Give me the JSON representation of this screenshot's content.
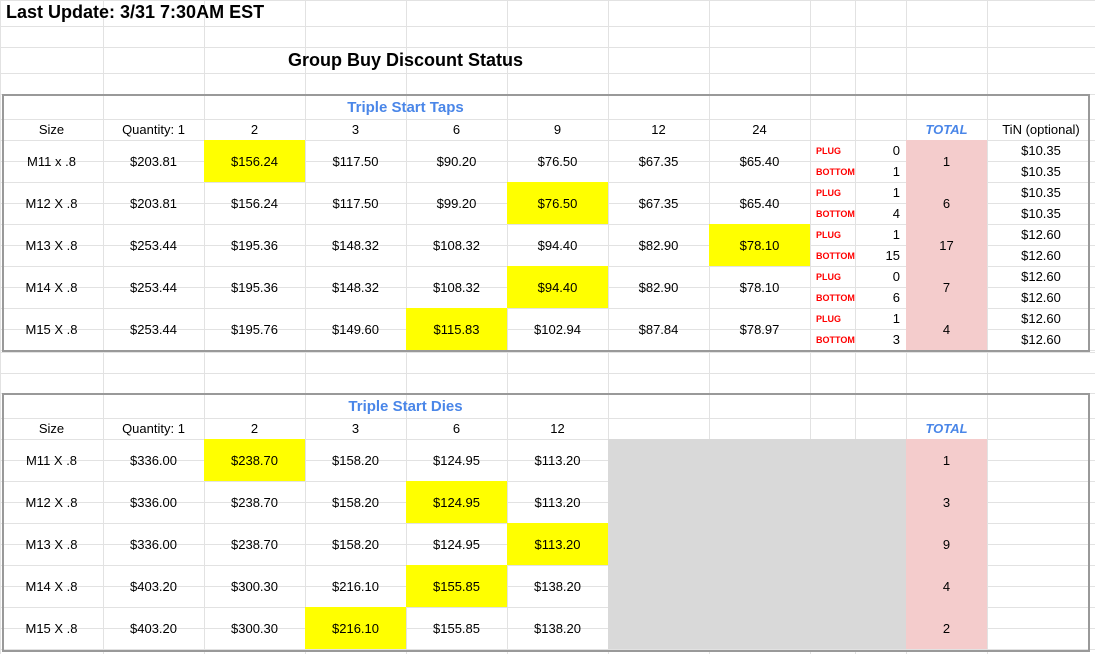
{
  "header": {
    "last_update": "Last Update: 3/31 7:30AM EST",
    "main_title": "Group Buy Discount Status"
  },
  "colors": {
    "highlight": "#ffff00",
    "total_fill": "#f4cccc",
    "blank_fill": "#d9d9d9",
    "section_title": "#4a86e8",
    "plug_bottom_text": "#ff0000"
  },
  "taps": {
    "title": "Triple Start Taps",
    "headers": [
      "Size",
      "Quantity: 1",
      "2",
      "3",
      "6",
      "9",
      "12",
      "24"
    ],
    "total_header": "TOTAL",
    "tin_header": "TiN (optional)",
    "plug_label": "PLUG",
    "bottom_label": "BOTTOM",
    "rows": [
      {
        "size": "M11 x .8",
        "prices": [
          "$203.81",
          "$156.24",
          "$117.50",
          "$90.20",
          "$76.50",
          "$67.35",
          "$65.40"
        ],
        "highlight": 1,
        "plug": "0",
        "bottom": "1",
        "total": "1",
        "tin_plug": "$10.35",
        "tin_bottom": "$10.35"
      },
      {
        "size": "M12 X .8",
        "prices": [
          "$203.81",
          "$156.24",
          "$117.50",
          "$99.20",
          "$76.50",
          "$67.35",
          "$65.40"
        ],
        "highlight": 4,
        "plug": "1",
        "bottom": "4",
        "total": "6",
        "tin_plug": "$10.35",
        "tin_bottom": "$10.35"
      },
      {
        "size": "M13 X .8",
        "prices": [
          "$253.44",
          "$195.36",
          "$148.32",
          "$108.32",
          "$94.40",
          "$82.90",
          "$78.10"
        ],
        "highlight": 6,
        "plug": "1",
        "bottom": "15",
        "total": "17",
        "tin_plug": "$12.60",
        "tin_bottom": "$12.60"
      },
      {
        "size": "M14 X .8",
        "prices": [
          "$253.44",
          "$195.36",
          "$148.32",
          "$108.32",
          "$94.40",
          "$82.90",
          "$78.10"
        ],
        "highlight": 4,
        "plug": "0",
        "bottom": "6",
        "total": "7",
        "tin_plug": "$12.60",
        "tin_bottom": "$12.60"
      },
      {
        "size": "M15 X .8",
        "prices": [
          "$253.44",
          "$195.76",
          "$149.60",
          "$115.83",
          "$102.94",
          "$87.84",
          "$78.97"
        ],
        "highlight": 3,
        "plug": "1",
        "bottom": "3",
        "total": "4",
        "tin_plug": "$12.60",
        "tin_bottom": "$12.60"
      }
    ]
  },
  "dies": {
    "title": "Triple Start Dies",
    "headers": [
      "Size",
      "Quantity: 1",
      "2",
      "3",
      "6",
      "12"
    ],
    "total_header": "TOTAL",
    "rows": [
      {
        "size": "M11 X .8",
        "prices": [
          "$336.00",
          "$238.70",
          "$158.20",
          "$124.95",
          "$113.20"
        ],
        "highlight": 1,
        "total": "1"
      },
      {
        "size": "M12 X .8",
        "prices": [
          "$336.00",
          "$238.70",
          "$158.20",
          "$124.95",
          "$113.20"
        ],
        "highlight": 3,
        "total": "3"
      },
      {
        "size": "M13 X .8",
        "prices": [
          "$336.00",
          "$238.70",
          "$158.20",
          "$124.95",
          "$113.20"
        ],
        "highlight": 4,
        "total": "9"
      },
      {
        "size": "M14 X .8",
        "prices": [
          "$403.20",
          "$300.30",
          "$216.10",
          "$155.85",
          "$138.20"
        ],
        "highlight": 3,
        "total": "4"
      },
      {
        "size": "M15 X .8",
        "prices": [
          "$403.20",
          "$300.30",
          "$216.10",
          "$155.85",
          "$138.20"
        ],
        "highlight": 2,
        "total": "2"
      }
    ]
  }
}
